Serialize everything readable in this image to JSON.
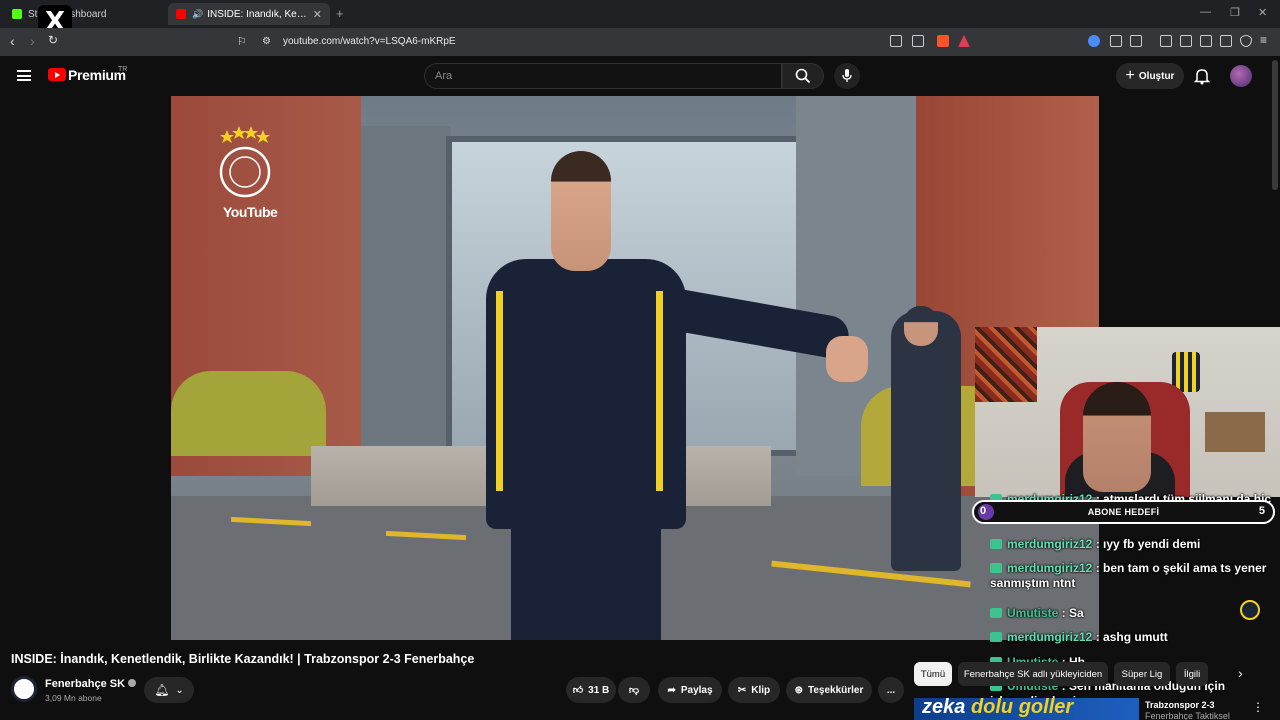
{
  "browser": {
    "tab1_title": "Stre... Dashboard",
    "tab2_title": "INSIDE: İnandık, Kenetlendik,",
    "new_tab": "+",
    "url": "youtube.com/watch?v=LSQA6-mKRpE",
    "x_logo": "X"
  },
  "yt": {
    "brand": "Premium",
    "region": "TR",
    "search_placeholder": "Ara",
    "create_label": "Oluştur"
  },
  "video": {
    "watermark": "YouTube",
    "title": "INSIDE: İnandık, Kenetlendik, Birlikte Kazandık! | Trabzonspor 2-3 Fenerbahçe"
  },
  "overlay": {
    "abone_label": "ABONE HEDEFİ",
    "abone_current": "0",
    "abone_target": "5",
    "chat": [
      {
        "user": "merdumgiriz12",
        "text": " : atmışlardı tüm şiilmanı da hiç bakmadım"
      },
      {
        "user": "merdumgiriz12",
        "text": " : ıyy fb yendi demi"
      },
      {
        "user": "merdumgiriz12",
        "text": " : ben tam o şekil ama ts yener sanmıştım ntnt"
      },
      {
        "user": "Umutiste",
        "text": " : Sa"
      },
      {
        "user": "merdumgiriz12",
        "text": " : ashg umutt"
      },
      {
        "user": "Umutiste",
        "text": " : Hb"
      },
      {
        "user": "Umutiste",
        "text": " : Sen manitanla olduğun için izlemedin demi"
      }
    ]
  },
  "channel": {
    "name": "Fenerbahçe SK",
    "subs": "3,09 Mn abone"
  },
  "actions": {
    "likes": "31 B",
    "share": "Paylaş",
    "clip": "Klip",
    "thanks": "Teşekkürler",
    "more": "..."
  },
  "chips": [
    "Tümü",
    "Fenerbahçe SK adlı yükleyiciden",
    "Süper Lig",
    "İlgili"
  ],
  "recommendation": {
    "thumb_text_1": "zeka",
    "thumb_text_2": "dolu",
    "thumb_text_3": "goller",
    "title": "Trabzonspor 2-3",
    "subtitle": "Fenerbahçe Taktiksel"
  },
  "colors": {
    "accent_red": "#ff0000",
    "chat_user": "#5ee0b4",
    "fb_yellow": "#f2d21f",
    "fb_navy": "#1c2538"
  }
}
